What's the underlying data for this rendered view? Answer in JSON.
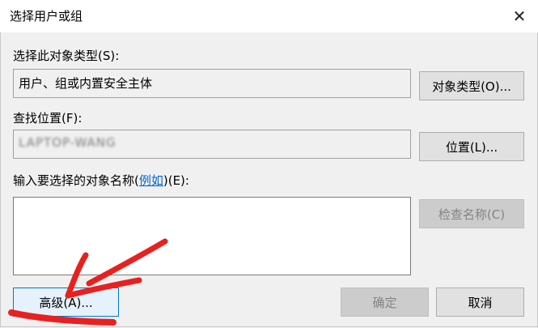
{
  "window": {
    "title": "选择用户或组",
    "close_icon": "close-icon",
    "close_glyph": "✕"
  },
  "object_type": {
    "label": "选择此对象类型(S):",
    "value": "用户、组或内置安全主体",
    "button": "对象类型(O)..."
  },
  "location": {
    "label": "查找位置(F):",
    "value": "LAPTOP-WANG",
    "button": "位置(L)..."
  },
  "object_names": {
    "label_prefix": "输入要选择的对象名称(",
    "label_link": "例如",
    "label_suffix": ")(E):",
    "value": "",
    "check_button": "检查名称(C)"
  },
  "footer": {
    "advanced_button": "高级(A)...",
    "ok_button": "确定",
    "cancel_button": "取消"
  },
  "annotation": {
    "color": "#e8201f"
  }
}
